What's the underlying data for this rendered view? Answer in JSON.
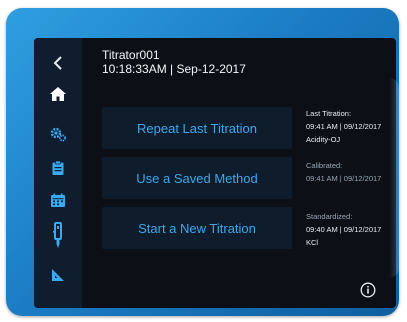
{
  "header": {
    "device_name": "Titrator001",
    "datetime": "10:18:33AM | Sep-12-2017"
  },
  "sidebar": {
    "items": [
      {
        "icon": "back-arrow-icon"
      },
      {
        "icon": "home-icon"
      },
      {
        "icon": "settings-gears-icon"
      },
      {
        "icon": "clipboard-icon"
      },
      {
        "icon": "calendar-icon"
      },
      {
        "icon": "electrode-icon"
      },
      {
        "icon": "ruler-triangle-icon"
      }
    ]
  },
  "actions": {
    "repeat_label": "Repeat Last Titration",
    "saved_label": "Use a Saved Method",
    "new_label": "Start a New Titration"
  },
  "info": {
    "last_titration_title": "Last Titration:",
    "last_titration_time": "09:41 AM | 09/12/2017",
    "last_titration_sample": "Acidity-OJ",
    "calibrated_title": "Calibrated:",
    "calibrated_time": "09:41 AM | 09/12/2017",
    "standardized_title": "Standardized:",
    "standardized_time": "09:40 AM | 09/12/2017",
    "standardized_reagent": "KCl"
  },
  "colors": {
    "accent": "#3aa9ef",
    "screen_bg": "#0c1016",
    "sidebar_bg": "#101d2e",
    "bezel": "#1b7cc4"
  }
}
